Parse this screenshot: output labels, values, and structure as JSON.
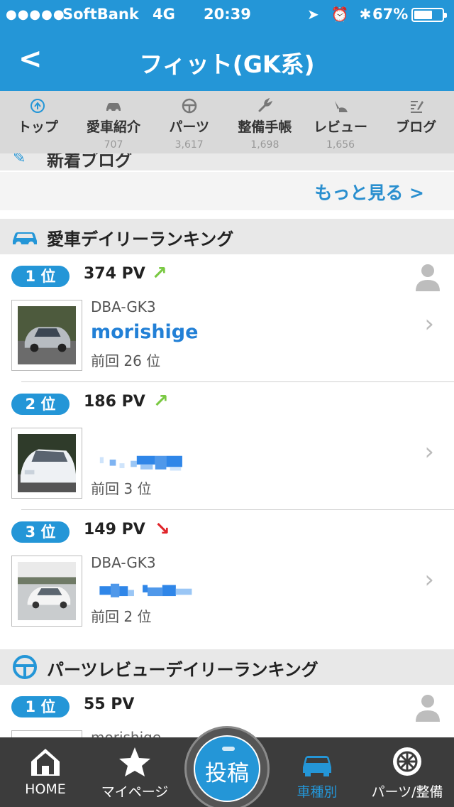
{
  "status_bar": {
    "signal_dots": "●●●●●",
    "carrier": "SoftBank",
    "network": "4G",
    "time": "20:39",
    "battery_pct": "67%",
    "battery_level": 0.67
  },
  "header": {
    "title": "フィット(GK系)",
    "back_label": "<"
  },
  "tabs": [
    {
      "label": "トップ",
      "count": "",
      "icon": "top-circle-icon"
    },
    {
      "label": "愛車紹介",
      "count": "707",
      "icon": "car-icon"
    },
    {
      "label": "パーツ",
      "count": "3,617",
      "icon": "steering-wheel-icon"
    },
    {
      "label": "整備手帳",
      "count": "1,698",
      "icon": "wrench-icon"
    },
    {
      "label": "レビュー",
      "count": "1,656",
      "icon": "review-icon"
    },
    {
      "label": "ブログ",
      "count": "",
      "icon": "blog-icon"
    }
  ],
  "new_blog": {
    "label": "新着ブログ",
    "more_label": "もっと見る >"
  },
  "car_ranking": {
    "title": "愛車デイリーランキング",
    "items": [
      {
        "rank": "1 位",
        "pv": "374 PV",
        "trend": "up",
        "trend_glyph": "↗",
        "model": "DBA-GK3",
        "user": "morishige",
        "prev": "前回 26 位"
      },
      {
        "rank": "2 位",
        "pv": "186 PV",
        "trend": "up",
        "trend_glyph": "↗",
        "model": "",
        "user": "",
        "prev": "前回 3 位"
      },
      {
        "rank": "3 位",
        "pv": "149 PV",
        "trend": "down",
        "trend_glyph": "↘",
        "model": "DBA-GK3",
        "user": "",
        "prev": "前回 2 位"
      }
    ]
  },
  "parts_ranking": {
    "title": "パーツレビューデイリーランキング",
    "items": [
      {
        "rank": "1 位",
        "pv": "55 PV",
        "user": "morishige"
      }
    ]
  },
  "bottom_bar": {
    "home": "HOME",
    "mypage": "マイページ",
    "post": "投稿",
    "by_model": "車種別",
    "parts": "パーツ/整備"
  },
  "colors": {
    "brand_blue": "#2496d7",
    "trend_up": "#7ac943",
    "trend_down": "#e0242a",
    "link_blue": "#2280d6"
  }
}
